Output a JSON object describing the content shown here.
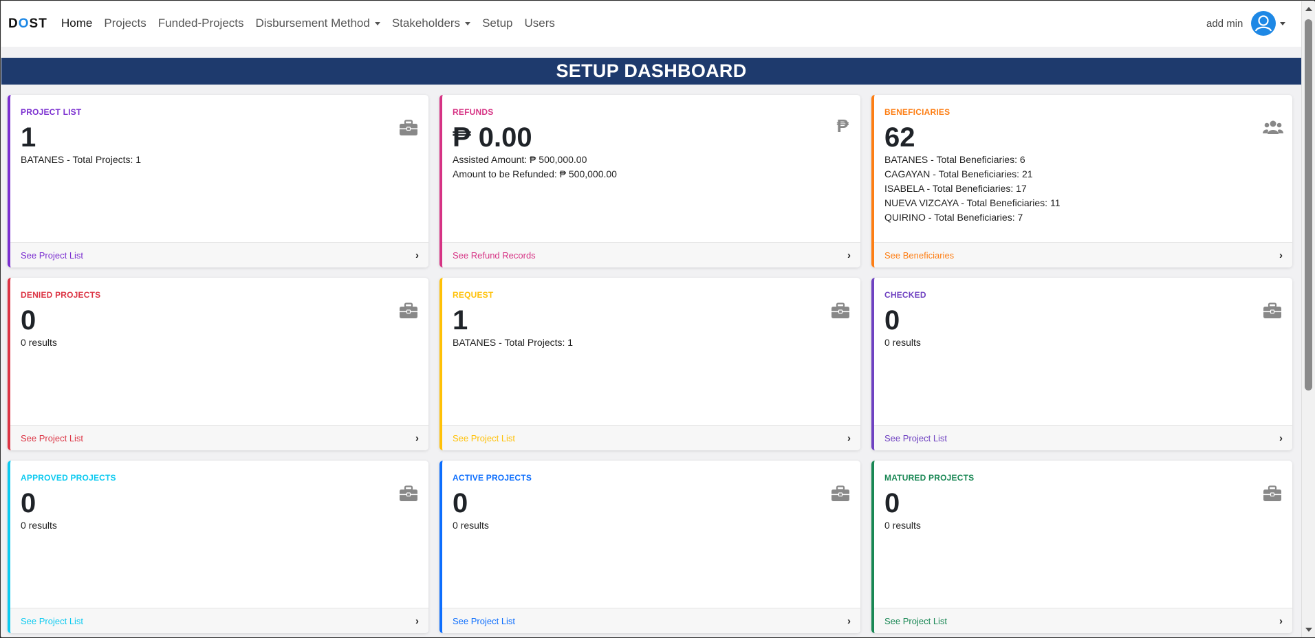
{
  "brand": {
    "d": "D",
    "o": "O",
    "st": "ST"
  },
  "nav": [
    {
      "label": "Home",
      "active": true,
      "dropdown": false
    },
    {
      "label": "Projects",
      "active": false,
      "dropdown": false
    },
    {
      "label": "Funded-Projects",
      "active": false,
      "dropdown": false
    },
    {
      "label": "Disbursement Method",
      "active": false,
      "dropdown": true
    },
    {
      "label": "Stakeholders",
      "active": false,
      "dropdown": true
    },
    {
      "label": "Setup",
      "active": false,
      "dropdown": false
    },
    {
      "label": "Users",
      "active": false,
      "dropdown": false
    }
  ],
  "user": {
    "name": "add min",
    "avatar_icon": "user-circle-icon"
  },
  "banner": {
    "title": "SETUP DASHBOARD"
  },
  "cards": [
    {
      "key": "project-list",
      "title": "PROJECT LIST",
      "value": "1",
      "color": "#7b2fd0",
      "icon": "briefcase-icon",
      "lines": [
        "BATANES - Total Projects: 1"
      ],
      "footer": "See Project List"
    },
    {
      "key": "refunds",
      "title": "REFUNDS",
      "value": "₱ 0.00",
      "color": "#d63384",
      "icon": "peso-icon",
      "lines": [
        "Assisted Amount: ₱ 500,000.00",
        "Amount to be Refunded: ₱ 500,000.00"
      ],
      "footer": "See Refund Records"
    },
    {
      "key": "beneficiaries",
      "title": "BENEFICIARIES",
      "value": "62",
      "color": "#fd7e14",
      "icon": "users-icon",
      "lines": [
        "BATANES - Total Beneficiaries: 6",
        "CAGAYAN - Total Beneficiaries: 21",
        "ISABELA - Total Beneficiaries: 17",
        "NUEVA VIZCAYA - Total Beneficiaries: 11",
        "QUIRINO - Total Beneficiaries: 7"
      ],
      "footer": "See Beneficiaries"
    },
    {
      "key": "denied-projects",
      "title": "DENIED PROJECTS",
      "value": "0",
      "color": "#dc3545",
      "icon": "briefcase-icon",
      "lines": [
        "0 results"
      ],
      "footer": "See Project List"
    },
    {
      "key": "request",
      "title": "REQUEST",
      "value": "1",
      "color": "#ffc107",
      "icon": "briefcase-icon",
      "lines": [
        "BATANES - Total Projects: 1"
      ],
      "footer": "See Project List"
    },
    {
      "key": "checked",
      "title": "CHECKED",
      "value": "0",
      "color": "#6f42c1",
      "icon": "briefcase-icon",
      "lines": [
        "0 results"
      ],
      "footer": "See Project List"
    },
    {
      "key": "approved-projects",
      "title": "APPROVED PROJECTS",
      "value": "0",
      "color": "#0dcaf0",
      "icon": "briefcase-icon",
      "lines": [
        "0 results"
      ],
      "footer": "See Project List"
    },
    {
      "key": "active-projects",
      "title": "ACTIVE PROJECTS",
      "value": "0",
      "color": "#0d6efd",
      "icon": "briefcase-icon",
      "lines": [
        "0 results"
      ],
      "footer": "See Project List"
    },
    {
      "key": "matured-projects",
      "title": "MATURED PROJECTS",
      "value": "0",
      "color": "#198754",
      "icon": "briefcase-icon",
      "lines": [
        "0 results"
      ],
      "footer": "See Project List"
    }
  ]
}
